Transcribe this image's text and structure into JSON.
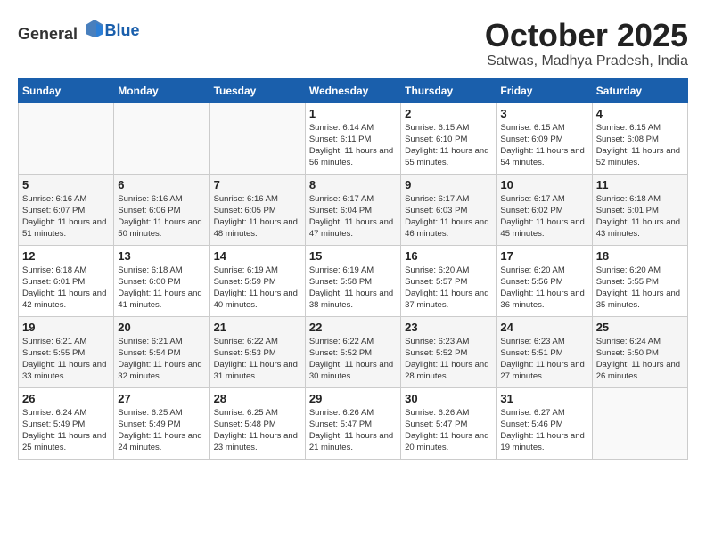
{
  "header": {
    "logo_general": "General",
    "logo_blue": "Blue",
    "month_year": "October 2025",
    "location": "Satwas, Madhya Pradesh, India"
  },
  "weekdays": [
    "Sunday",
    "Monday",
    "Tuesday",
    "Wednesday",
    "Thursday",
    "Friday",
    "Saturday"
  ],
  "weeks": [
    [
      {
        "day": "",
        "sunrise": "",
        "sunset": "",
        "daylight": ""
      },
      {
        "day": "",
        "sunrise": "",
        "sunset": "",
        "daylight": ""
      },
      {
        "day": "",
        "sunrise": "",
        "sunset": "",
        "daylight": ""
      },
      {
        "day": "1",
        "sunrise": "Sunrise: 6:14 AM",
        "sunset": "Sunset: 6:11 PM",
        "daylight": "Daylight: 11 hours and 56 minutes."
      },
      {
        "day": "2",
        "sunrise": "Sunrise: 6:15 AM",
        "sunset": "Sunset: 6:10 PM",
        "daylight": "Daylight: 11 hours and 55 minutes."
      },
      {
        "day": "3",
        "sunrise": "Sunrise: 6:15 AM",
        "sunset": "Sunset: 6:09 PM",
        "daylight": "Daylight: 11 hours and 54 minutes."
      },
      {
        "day": "4",
        "sunrise": "Sunrise: 6:15 AM",
        "sunset": "Sunset: 6:08 PM",
        "daylight": "Daylight: 11 hours and 52 minutes."
      }
    ],
    [
      {
        "day": "5",
        "sunrise": "Sunrise: 6:16 AM",
        "sunset": "Sunset: 6:07 PM",
        "daylight": "Daylight: 11 hours and 51 minutes."
      },
      {
        "day": "6",
        "sunrise": "Sunrise: 6:16 AM",
        "sunset": "Sunset: 6:06 PM",
        "daylight": "Daylight: 11 hours and 50 minutes."
      },
      {
        "day": "7",
        "sunrise": "Sunrise: 6:16 AM",
        "sunset": "Sunset: 6:05 PM",
        "daylight": "Daylight: 11 hours and 48 minutes."
      },
      {
        "day": "8",
        "sunrise": "Sunrise: 6:17 AM",
        "sunset": "Sunset: 6:04 PM",
        "daylight": "Daylight: 11 hours and 47 minutes."
      },
      {
        "day": "9",
        "sunrise": "Sunrise: 6:17 AM",
        "sunset": "Sunset: 6:03 PM",
        "daylight": "Daylight: 11 hours and 46 minutes."
      },
      {
        "day": "10",
        "sunrise": "Sunrise: 6:17 AM",
        "sunset": "Sunset: 6:02 PM",
        "daylight": "Daylight: 11 hours and 45 minutes."
      },
      {
        "day": "11",
        "sunrise": "Sunrise: 6:18 AM",
        "sunset": "Sunset: 6:01 PM",
        "daylight": "Daylight: 11 hours and 43 minutes."
      }
    ],
    [
      {
        "day": "12",
        "sunrise": "Sunrise: 6:18 AM",
        "sunset": "Sunset: 6:01 PM",
        "daylight": "Daylight: 11 hours and 42 minutes."
      },
      {
        "day": "13",
        "sunrise": "Sunrise: 6:18 AM",
        "sunset": "Sunset: 6:00 PM",
        "daylight": "Daylight: 11 hours and 41 minutes."
      },
      {
        "day": "14",
        "sunrise": "Sunrise: 6:19 AM",
        "sunset": "Sunset: 5:59 PM",
        "daylight": "Daylight: 11 hours and 40 minutes."
      },
      {
        "day": "15",
        "sunrise": "Sunrise: 6:19 AM",
        "sunset": "Sunset: 5:58 PM",
        "daylight": "Daylight: 11 hours and 38 minutes."
      },
      {
        "day": "16",
        "sunrise": "Sunrise: 6:20 AM",
        "sunset": "Sunset: 5:57 PM",
        "daylight": "Daylight: 11 hours and 37 minutes."
      },
      {
        "day": "17",
        "sunrise": "Sunrise: 6:20 AM",
        "sunset": "Sunset: 5:56 PM",
        "daylight": "Daylight: 11 hours and 36 minutes."
      },
      {
        "day": "18",
        "sunrise": "Sunrise: 6:20 AM",
        "sunset": "Sunset: 5:55 PM",
        "daylight": "Daylight: 11 hours and 35 minutes."
      }
    ],
    [
      {
        "day": "19",
        "sunrise": "Sunrise: 6:21 AM",
        "sunset": "Sunset: 5:55 PM",
        "daylight": "Daylight: 11 hours and 33 minutes."
      },
      {
        "day": "20",
        "sunrise": "Sunrise: 6:21 AM",
        "sunset": "Sunset: 5:54 PM",
        "daylight": "Daylight: 11 hours and 32 minutes."
      },
      {
        "day": "21",
        "sunrise": "Sunrise: 6:22 AM",
        "sunset": "Sunset: 5:53 PM",
        "daylight": "Daylight: 11 hours and 31 minutes."
      },
      {
        "day": "22",
        "sunrise": "Sunrise: 6:22 AM",
        "sunset": "Sunset: 5:52 PM",
        "daylight": "Daylight: 11 hours and 30 minutes."
      },
      {
        "day": "23",
        "sunrise": "Sunrise: 6:23 AM",
        "sunset": "Sunset: 5:52 PM",
        "daylight": "Daylight: 11 hours and 28 minutes."
      },
      {
        "day": "24",
        "sunrise": "Sunrise: 6:23 AM",
        "sunset": "Sunset: 5:51 PM",
        "daylight": "Daylight: 11 hours and 27 minutes."
      },
      {
        "day": "25",
        "sunrise": "Sunrise: 6:24 AM",
        "sunset": "Sunset: 5:50 PM",
        "daylight": "Daylight: 11 hours and 26 minutes."
      }
    ],
    [
      {
        "day": "26",
        "sunrise": "Sunrise: 6:24 AM",
        "sunset": "Sunset: 5:49 PM",
        "daylight": "Daylight: 11 hours and 25 minutes."
      },
      {
        "day": "27",
        "sunrise": "Sunrise: 6:25 AM",
        "sunset": "Sunset: 5:49 PM",
        "daylight": "Daylight: 11 hours and 24 minutes."
      },
      {
        "day": "28",
        "sunrise": "Sunrise: 6:25 AM",
        "sunset": "Sunset: 5:48 PM",
        "daylight": "Daylight: 11 hours and 23 minutes."
      },
      {
        "day": "29",
        "sunrise": "Sunrise: 6:26 AM",
        "sunset": "Sunset: 5:47 PM",
        "daylight": "Daylight: 11 hours and 21 minutes."
      },
      {
        "day": "30",
        "sunrise": "Sunrise: 6:26 AM",
        "sunset": "Sunset: 5:47 PM",
        "daylight": "Daylight: 11 hours and 20 minutes."
      },
      {
        "day": "31",
        "sunrise": "Sunrise: 6:27 AM",
        "sunset": "Sunset: 5:46 PM",
        "daylight": "Daylight: 11 hours and 19 minutes."
      },
      {
        "day": "",
        "sunrise": "",
        "sunset": "",
        "daylight": ""
      }
    ]
  ]
}
